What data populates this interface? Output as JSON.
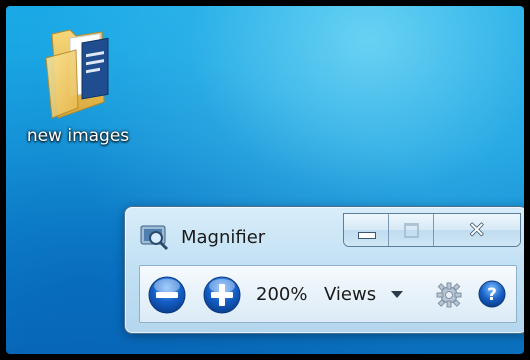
{
  "desktop": {
    "icon": {
      "name": "folder-icon",
      "label": "new images"
    }
  },
  "magnifier": {
    "title": "Magnifier",
    "caption": {
      "minimize": "minimize",
      "maximize": "maximize",
      "close": "close"
    },
    "toolbar": {
      "zoom_out_icon": "minus-circle-icon",
      "zoom_in_icon": "plus-circle-icon",
      "zoom_level": "200%",
      "views_label": "Views",
      "options_icon": "gear-icon",
      "help_icon": "help-icon"
    }
  },
  "colors": {
    "desktop_blue": "#19a0e0",
    "button_blue": "#1560c8",
    "window_frame": "#c3e1f4"
  }
}
